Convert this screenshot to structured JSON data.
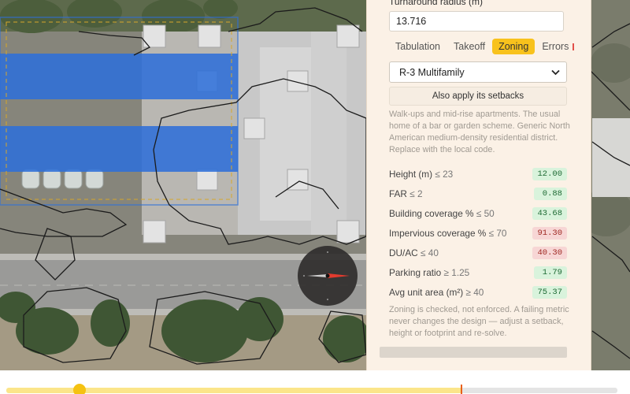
{
  "panel": {
    "turnaround_label": "Turnaround radius (m)",
    "turnaround_value": "13.716",
    "tabs": [
      {
        "label": "Tabulation",
        "active": false
      },
      {
        "label": "Takeoff",
        "active": false
      },
      {
        "label": "Zoning",
        "active": true
      },
      {
        "label": "Errors",
        "active": false
      }
    ],
    "zoning_district": "R-3 Multifamily",
    "apply_setbacks_label": "Also apply its setbacks",
    "description": "Walk-ups and mid-rise apartments. The usual home of a bar or garden scheme. Generic North American medium-density residential district. Replace with the local code.",
    "metrics": [
      {
        "name": "Height (m)",
        "limit": "≤ 23",
        "value": "12.00",
        "status": "pass"
      },
      {
        "name": "FAR",
        "limit": "≤ 2",
        "value": "0.88",
        "status": "pass"
      },
      {
        "name": "Building coverage %",
        "limit": "≤ 50",
        "value": "43.68",
        "status": "pass"
      },
      {
        "name": "Impervious coverage %",
        "limit": "≤ 70",
        "value": "91.30",
        "status": "fail"
      },
      {
        "name": "DU/AC",
        "limit": "≤ 40",
        "value": "40.30",
        "status": "fail"
      },
      {
        "name": "Parking ratio",
        "limit": "≥ 1.25",
        "value": "1.79",
        "status": "pass"
      },
      {
        "name": "Avg unit area (m²)",
        "limit": "≥ 40",
        "value": "75.37",
        "status": "pass"
      }
    ],
    "note": "Zoning is checked, not enforced. A failing metric never changes the design — adjust a setback, height or footprint and re-solve."
  },
  "colors": {
    "accent": "#f8c21c",
    "pass_bg": "#d9f3dc",
    "fail_bg": "#f7d6d5",
    "building_overlay": "#2f6fd8"
  },
  "timeline": {
    "progress_fraction": 0.745,
    "knob_fraction": 0.12
  },
  "icons": {
    "compass": "compass-icon",
    "select_caret": "chevron-down-icon"
  }
}
